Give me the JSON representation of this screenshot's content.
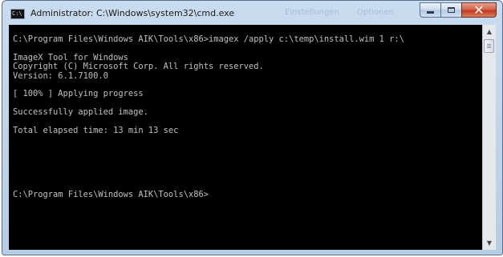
{
  "window": {
    "title": "Administrator: C:\\Windows\\system32\\cmd.exe",
    "icon": "cmd-icon",
    "icon_text": "C:\\",
    "ghost_tabs": [
      "Einstellungen",
      "Optionen"
    ]
  },
  "caption_buttons": {
    "minimize_icon": "minimize-icon",
    "maximize_icon": "maximize-icon",
    "close_glyph": "✕"
  },
  "console": {
    "lines": [
      "C:\\Program Files\\Windows AIK\\Tools\\x86>imagex /apply c:\\temp\\install.wim 1 r:\\",
      "",
      "ImageX Tool for Windows",
      "Copyright (C) Microsoft Corp. All rights reserved.",
      "Version: 6.1.7100.0",
      "",
      "[ 100% ] Applying progress",
      "",
      "Successfully applied image.",
      "",
      "Total elapsed time: 13 min 13 sec",
      "",
      "",
      "",
      "",
      "",
      "",
      "C:\\Program Files\\Windows AIK\\Tools\\x86>"
    ]
  },
  "scrollbar": {
    "up_glyph": "▲",
    "down_glyph": "▼",
    "position": 0
  }
}
